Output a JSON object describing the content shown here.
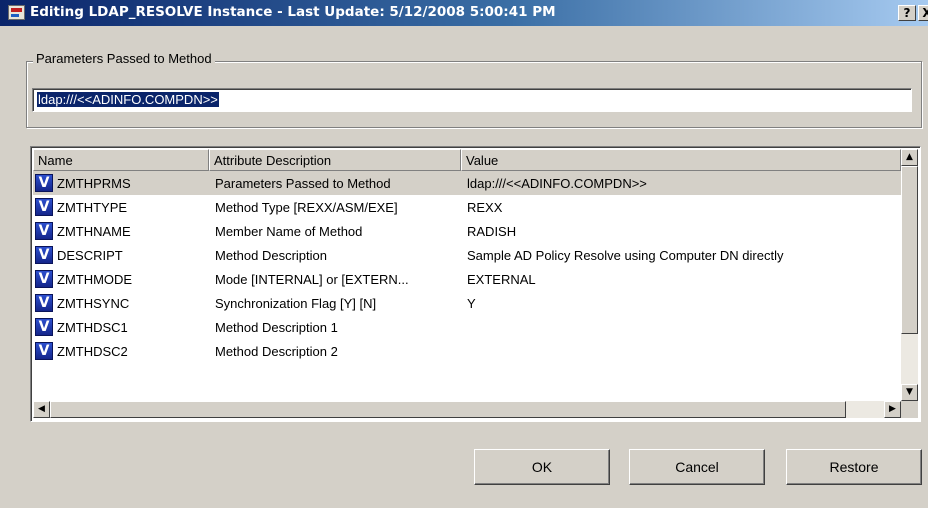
{
  "window": {
    "title": "Editing LDAP_RESOLVE Instance - Last Update: 5/12/2008 5:00:41 PM",
    "help_label": "?",
    "close_label": "X"
  },
  "parameters_group": {
    "legend": "Parameters Passed to Method",
    "value": "ldap:///<<ADINFO.COMPDN>>"
  },
  "table": {
    "columns": [
      "Name",
      "Attribute Description",
      "Value"
    ],
    "rows": [
      {
        "icon": "V",
        "name": "ZMTHPRMS",
        "attr": "Parameters Passed to Method",
        "value": "ldap:///<<ADINFO.COMPDN>>",
        "selected": true
      },
      {
        "icon": "V",
        "name": "ZMTHTYPE",
        "attr": "Method Type [REXX/ASM/EXE]",
        "value": "REXX"
      },
      {
        "icon": "V",
        "name": "ZMTHNAME",
        "attr": "Member Name of Method",
        "value": "RADISH"
      },
      {
        "icon": "V",
        "name": "DESCRIPT",
        "attr": "Method Description",
        "value": "Sample AD Policy Resolve using Computer DN directly"
      },
      {
        "icon": "V",
        "name": "ZMTHMODE",
        "attr": "Mode [INTERNAL] or [EXTERN...",
        "value": "EXTERNAL"
      },
      {
        "icon": "V",
        "name": "ZMTHSYNC",
        "attr": "Synchronization Flag [Y] [N]",
        "value": "Y"
      },
      {
        "icon": "V",
        "name": "ZMTHDSC1",
        "attr": "Method Description 1",
        "value": ""
      },
      {
        "icon": "V",
        "name": "ZMTHDSC2",
        "attr": "Method Description 2",
        "value": ""
      }
    ]
  },
  "scroll": {
    "up_glyph": "▲",
    "down_glyph": "▼",
    "left_glyph": "◀",
    "right_glyph": "▶"
  },
  "buttons": {
    "ok": "OK",
    "cancel": "Cancel",
    "restore": "Restore"
  },
  "colors": {
    "title_bar": "#0a246a",
    "selection": "#0a246a",
    "dialog_bg": "#d4d0c8",
    "v_icon": "#1f36b0"
  }
}
